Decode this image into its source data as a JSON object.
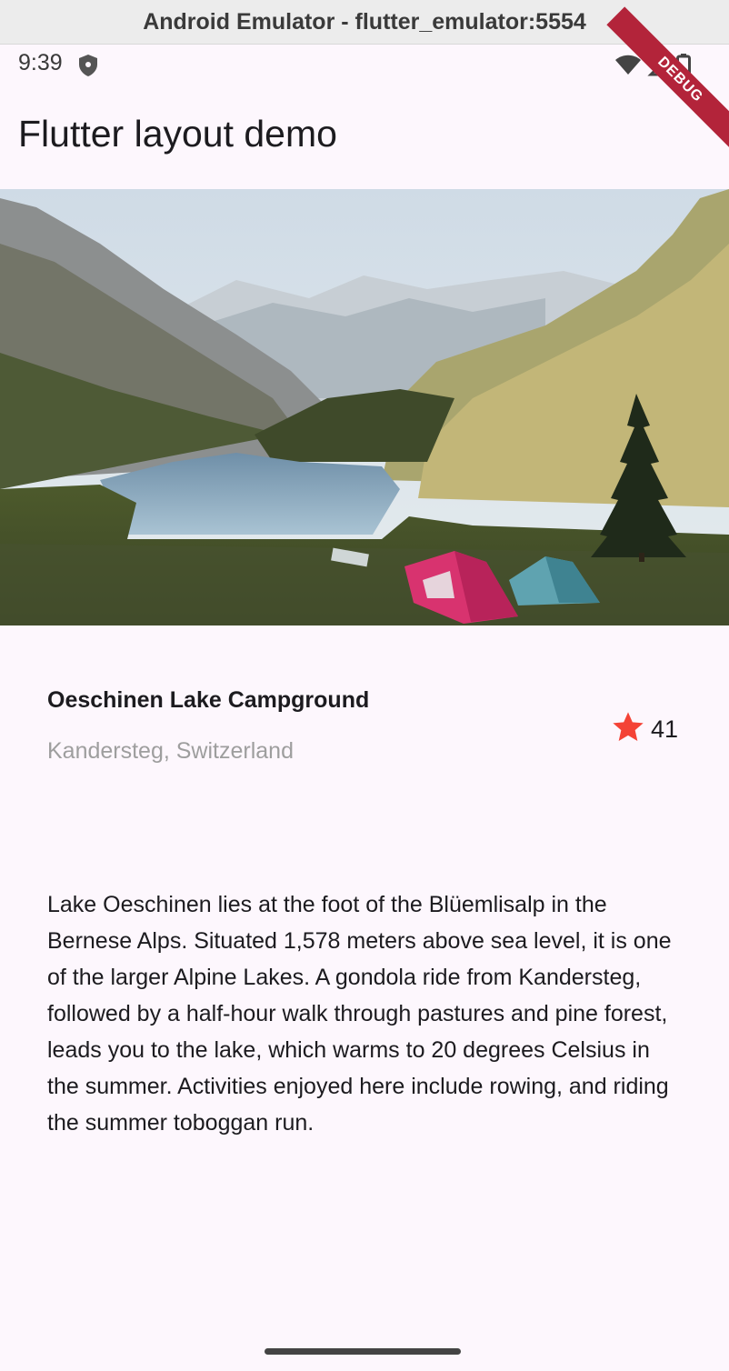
{
  "window": {
    "title": "Android Emulator - flutter_emulator:5554"
  },
  "status_bar": {
    "time": "9:39",
    "debug_label": "DEBUG"
  },
  "app_bar": {
    "title": "Flutter layout demo"
  },
  "hero_image": {
    "subject": "mountain-lake-campground-photo"
  },
  "title_section": {
    "name": "Oeschinen Lake Campground",
    "location": "Kandersteg, Switzerland",
    "rating_icon": "star-icon",
    "rating_count": "41",
    "star_color": "#f44336"
  },
  "description": "Lake Oeschinen lies at the foot of the Blüemlisalp in the Bernese Alps. Situated 1,578 meters above sea level, it is one of the larger Alpine Lakes. A gondola ride from Kandersteg, followed by a half-hour walk through pastures and pine forest, leads you to the lake, which warms to 20 degrees Celsius in the summer. Activities enjoyed here include rowing, and riding the summer toboggan run."
}
